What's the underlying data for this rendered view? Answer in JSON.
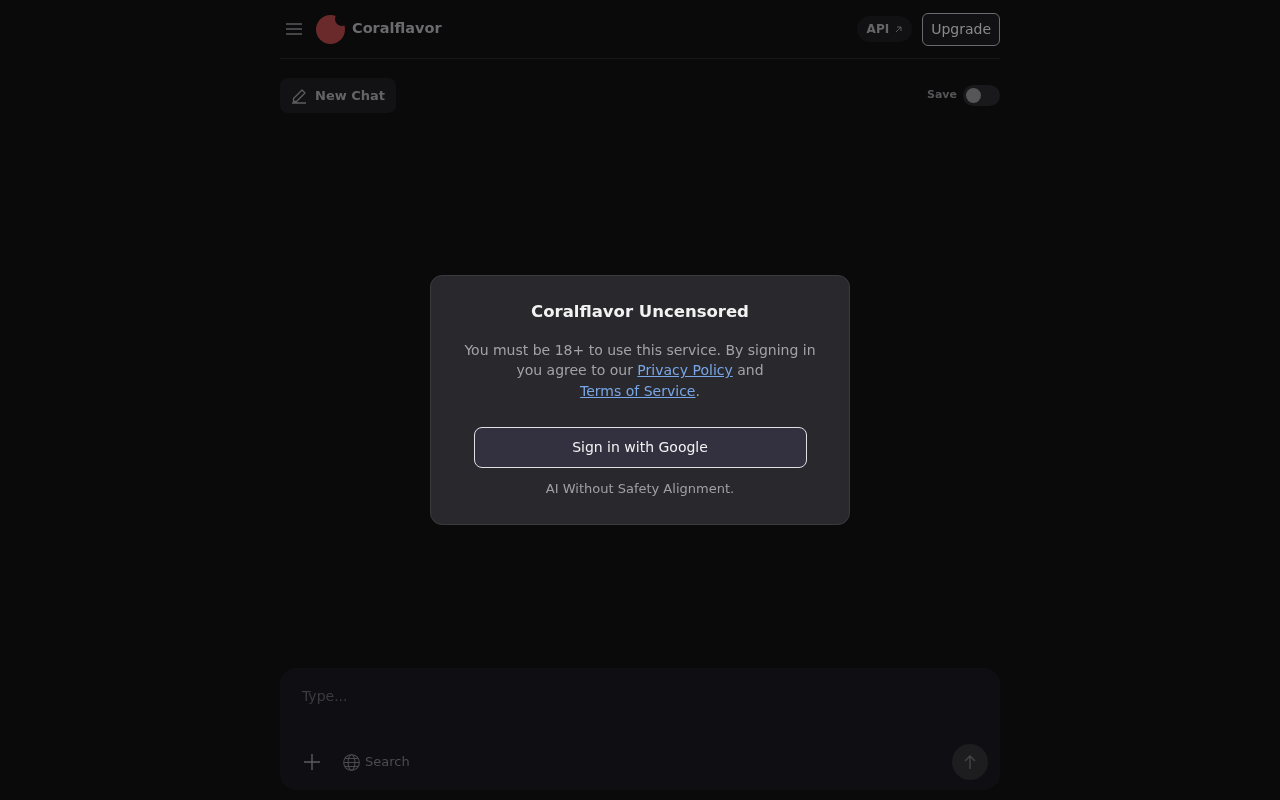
{
  "header": {
    "brand": "Coralflavor",
    "api_link": "API",
    "upgrade_button": "Upgrade"
  },
  "toolbar": {
    "new_chat_button": "New Chat",
    "save_toggle": {
      "label": "Save",
      "on": false
    }
  },
  "dialog": {
    "title": "Coralflavor Uncensored",
    "message_parts": [
      {
        "kind": "text",
        "text": "You must be 18+ to use this service. By signing in you agree to our "
      },
      {
        "kind": "link",
        "text": "Privacy Policy"
      },
      {
        "kind": "text",
        "text": " and "
      },
      {
        "kind": "link",
        "text": "Terms of Service"
      },
      {
        "kind": "text",
        "text": "."
      }
    ],
    "sign_in_button": "Sign in with Google",
    "footer": "AI Without Safety Alignment."
  },
  "composer": {
    "placeholder": "Type...",
    "search_button": "Search"
  }
}
